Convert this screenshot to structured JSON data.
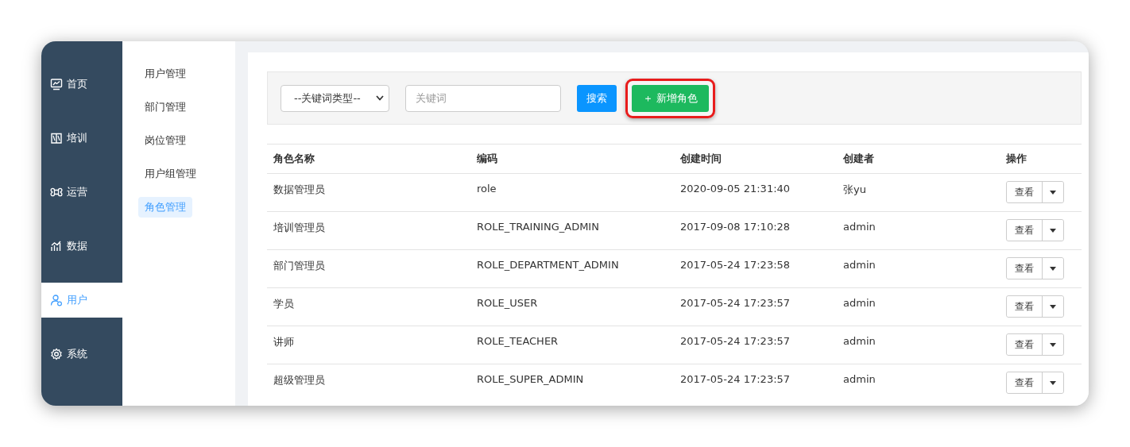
{
  "nav": [
    {
      "label": "首页",
      "selected": false
    },
    {
      "label": "培训",
      "selected": false
    },
    {
      "label": "运营",
      "selected": false
    },
    {
      "label": "数据",
      "selected": false
    },
    {
      "label": "用户",
      "selected": true
    },
    {
      "label": "系统",
      "selected": false
    }
  ],
  "submenu": [
    {
      "label": "用户管理",
      "selected": false
    },
    {
      "label": "部门管理",
      "selected": false
    },
    {
      "label": "岗位管理",
      "selected": false
    },
    {
      "label": "用户组管理",
      "selected": false
    },
    {
      "label": "角色管理",
      "selected": true
    }
  ],
  "search": {
    "keyword_type": "--关键词类型--",
    "keyword_placeholder": "关键词",
    "search_button": "搜索",
    "add_button": "新增角色",
    "add_icon": "＋",
    "add_highlighted": true
  },
  "table": {
    "columns": [
      "角色名称",
      "编码",
      "创建时间",
      "创建者",
      "操作"
    ],
    "rows": [
      {
        "name": "数据管理员",
        "code": "role",
        "created": "2020-09-05 21:31:40",
        "creator": "张yu",
        "action": "查看"
      },
      {
        "name": "培训管理员",
        "code": "ROLE_TRAINING_ADMIN",
        "created": "2017-09-08 17:10:28",
        "creator": "admin",
        "action": "查看"
      },
      {
        "name": "部门管理员",
        "code": "ROLE_DEPARTMENT_ADMIN",
        "created": "2017-05-24 17:23:58",
        "creator": "admin",
        "action": "查看"
      },
      {
        "name": "学员",
        "code": "ROLE_USER",
        "created": "2017-05-24 17:23:57",
        "creator": "admin",
        "action": "查看"
      },
      {
        "name": "讲师",
        "code": "ROLE_TEACHER",
        "created": "2017-05-24 17:23:57",
        "creator": "admin",
        "action": "查看"
      },
      {
        "name": "超级管理员",
        "code": "ROLE_SUPER_ADMIN",
        "created": "2017-05-24 17:23:57",
        "creator": "admin",
        "action": "查看"
      }
    ]
  }
}
